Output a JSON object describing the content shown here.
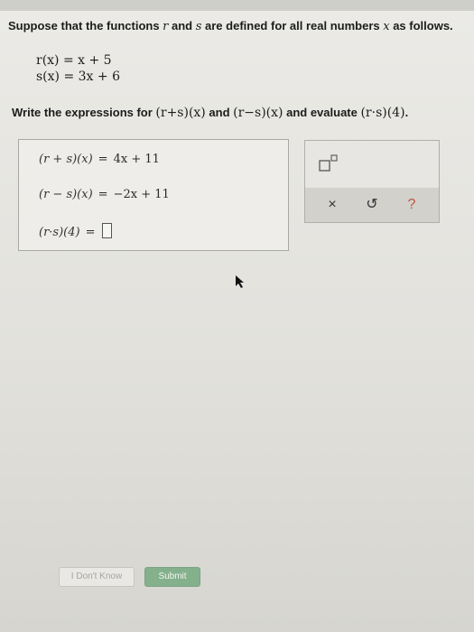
{
  "problem": {
    "prompt_start": "Suppose that the functions ",
    "var_r": "r",
    "word_and": " and ",
    "var_s": "s",
    "prompt_mid": " are defined for all real numbers ",
    "var_x": "x",
    "prompt_end": " as follows.",
    "def_r": "r(x) = x + 5",
    "def_s": "s(x) = 3x + 6",
    "instruction_start": "Write the expressions for ",
    "expr_sum": "(r+s)(x)",
    "instruction_and": " and ",
    "expr_diff": "(r−s)(x)",
    "instruction_mid": " and evaluate ",
    "expr_prod": "(r·s)(4)",
    "instruction_end": "."
  },
  "answers": {
    "sum_lhs": "(r + s)(x)",
    "sum_value": "4x + 11",
    "diff_lhs": "(r − s)(x)",
    "diff_value": "−2x + 11",
    "prod_lhs": "(r·s)(4)",
    "prod_value": "",
    "equals": "="
  },
  "tools": {
    "superscript_icon": "superscript-box-icon",
    "clear": "×",
    "undo": "↺",
    "help": "?"
  },
  "buttons": {
    "dont_know": "I Don't Know",
    "submit": "Submit"
  },
  "colors": {
    "submit_bg": "#84b08c",
    "tool_accent": "#c0563a"
  }
}
